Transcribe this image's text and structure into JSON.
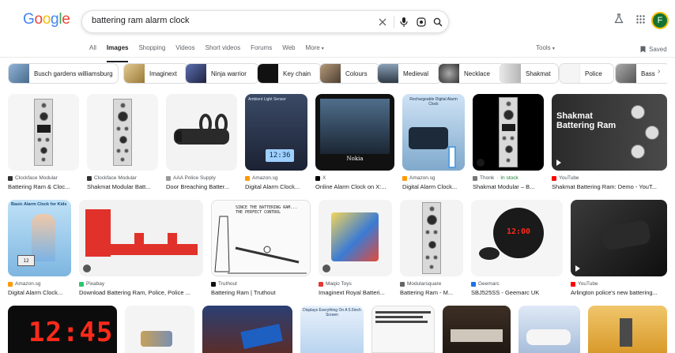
{
  "logo": [
    "G",
    "o",
    "o",
    "g",
    "l",
    "e"
  ],
  "search": {
    "query": "battering ram alarm clock"
  },
  "avatar_letter": "F",
  "tabs": [
    {
      "label": "All"
    },
    {
      "label": "Images"
    },
    {
      "label": "Shopping"
    },
    {
      "label": "Videos"
    },
    {
      "label": "Short videos"
    },
    {
      "label": "Forums"
    },
    {
      "label": "Web"
    },
    {
      "label": "More"
    }
  ],
  "tools_label": "Tools",
  "saved_label": "Saved",
  "chips": [
    {
      "label": "Busch gardens williamsburg",
      "color": "#6a8fb3"
    },
    {
      "label": "Imaginext",
      "color": "#c7a86b"
    },
    {
      "label": "Ninja warrior",
      "color": "#3a3f6b"
    },
    {
      "label": "Key chain",
      "color": "#111111"
    },
    {
      "label": "Colours",
      "color": "#7a6a5a"
    },
    {
      "label": "Medieval",
      "color": "#4b5b6b"
    },
    {
      "label": "Necklace",
      "color": "#555555"
    },
    {
      "label": "Shakmat",
      "color": "#cfcfcf"
    },
    {
      "label": "Police",
      "color": "#f0f0f0"
    },
    {
      "label": "Bass",
      "color": "#8a8a8a"
    }
  ],
  "results_row1": [
    {
      "source": "Clockface Modular",
      "title": "Battering Ram & Cloc...",
      "fav": "#333333"
    },
    {
      "source": "Clockface Modular",
      "title": "Shakmat Modular Batt...",
      "fav": "#333333"
    },
    {
      "source": "AAA Police Supply",
      "title": "Door Breaching Batter...",
      "fav": "#999999"
    },
    {
      "source": "Amazon.sg",
      "title": "Digital Alarm Clock...",
      "fav": "#ff9900"
    },
    {
      "source": "X",
      "title": "Online Alarm Clock on X:...",
      "fav": "#000000"
    },
    {
      "source": "Amazon.sg",
      "title": "Digital Alarm Clock...",
      "fav": "#ff9900"
    },
    {
      "source": "Thonk",
      "stock": "In stock",
      "title": "Shakmat Modular – B...",
      "fav": "#777777"
    },
    {
      "source": "YouTube",
      "title": "Shakmat Battering Ram: Demo - YouT...",
      "fav": "#ff0000"
    }
  ],
  "results_row2": [
    {
      "source": "Amazon.sg",
      "title": "Digital Alarm Clock...",
      "fav": "#ff9900"
    },
    {
      "source": "Pixabay",
      "title": "Download Battering Ram, Police, Police ...",
      "fav": "#2ec66d"
    },
    {
      "source": "Truthout",
      "title": "Battering Ram | Truthout",
      "fav": "#111111"
    },
    {
      "source": "Maqio Toys",
      "title": "Imaginext Royal Batteri...",
      "fav": "#e53935"
    },
    {
      "source": "Modularsquare",
      "title": "Battering Ram - M...",
      "fav": "#666666"
    },
    {
      "source": "Geemarc",
      "title": "SBJ525SS - Geemarc UK",
      "fav": "#1a73e8"
    },
    {
      "source": "YouTube",
      "title": "Arlington police's new battering...",
      "fav": "#ff0000"
    }
  ],
  "image_text": {
    "lcd1": "12:36",
    "nokia": "Nokia",
    "shakmat_title": "Shakmat\nBattering Ram",
    "basic_alarm": "Basic Alarm Clock for Kids",
    "sonic_time": "12:00",
    "big_clock": "12:45",
    "ambient": "Ambient Light Sensor",
    "rechargeable": "Rechargeable Digital Alarm Clock",
    "cartoon": "SINCE THE BATTERING RAM... THE PERFECT CONTROL",
    "displays": "Displays Everything On A 5.5inch Screen"
  }
}
